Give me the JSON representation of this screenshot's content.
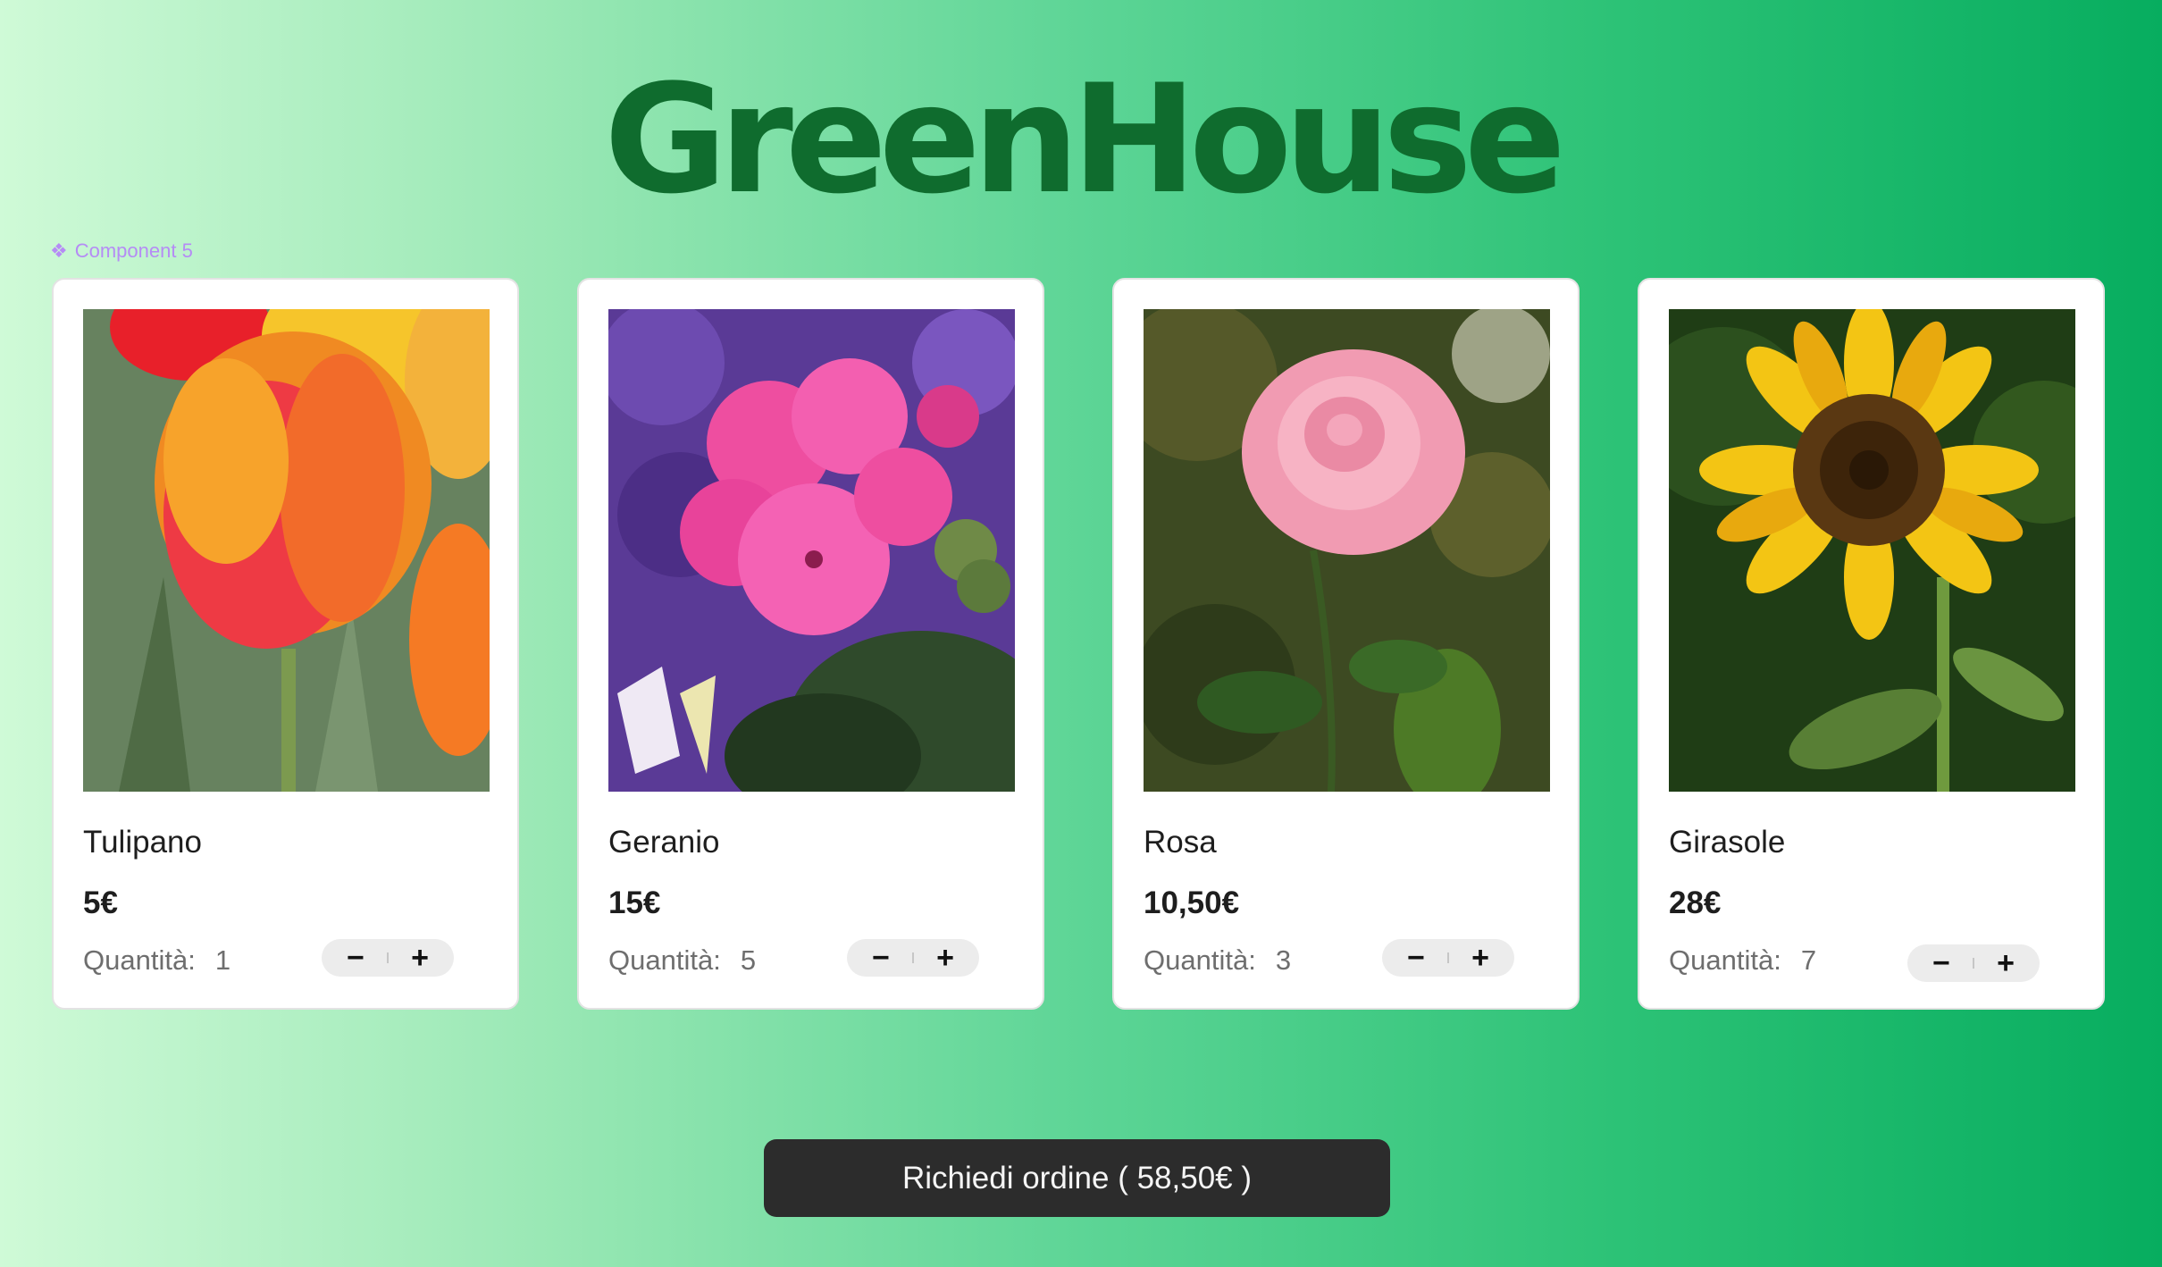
{
  "app": {
    "title": "GreenHouse"
  },
  "component_label": "Component 5",
  "products": [
    {
      "name": "Tulipano",
      "price": "5€",
      "qty_label": "Quantità:",
      "qty": "1",
      "minus": "−",
      "plus": "+"
    },
    {
      "name": "Geranio",
      "price": "15€",
      "qty_label": "Quantità:",
      "qty": "5",
      "minus": "−",
      "plus": "+"
    },
    {
      "name": "Rosa",
      "price": "10,50€",
      "qty_label": "Quantità:",
      "qty": "3",
      "minus": "−",
      "plus": "+"
    },
    {
      "name": "Girasole",
      "price": "28€",
      "qty_label": "Quantità:",
      "qty": "7",
      "minus": "−",
      "plus": "+"
    }
  ],
  "order_button": {
    "label": "Richiedi ordine ( 58,50€ )"
  },
  "colors": {
    "brand": "#0f6c2e",
    "background_start": "#cffad7",
    "background_end": "#07ad5f",
    "button": "#2c2c2c",
    "component_label": "#b58cf5"
  }
}
